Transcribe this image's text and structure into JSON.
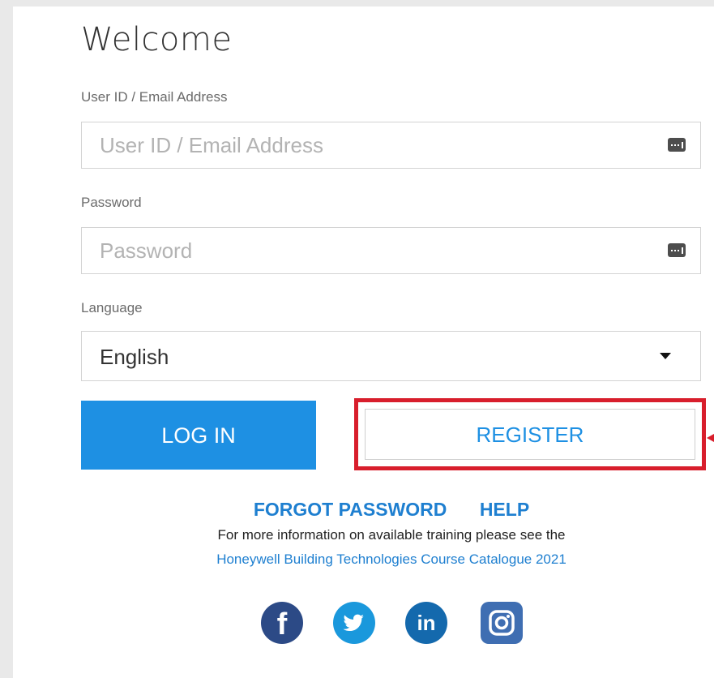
{
  "welcome": "Welcome",
  "user_label": "User ID / Email Address",
  "user_placeholder": "User ID / Email Address",
  "password_label": "Password",
  "password_placeholder": "Password",
  "language_label": "Language",
  "language_value": "English",
  "login_label": "LOG IN",
  "register_label": "REGISTER",
  "links": {
    "forgot": "FORGOT PASSWORD",
    "help": "HELP"
  },
  "info_text": "For more information on available training please see the",
  "catalogue_link": "Honeywell Building Technologies Course Catalogue 2021",
  "icons": [
    "key-icon",
    "chevron-down-icon",
    "facebook-icon",
    "twitter-icon",
    "linkedin-icon",
    "instagram-icon"
  ],
  "colors": {
    "accent": "#1e90e3",
    "highlight": "#d81e2c",
    "link": "#1e7fd0"
  }
}
